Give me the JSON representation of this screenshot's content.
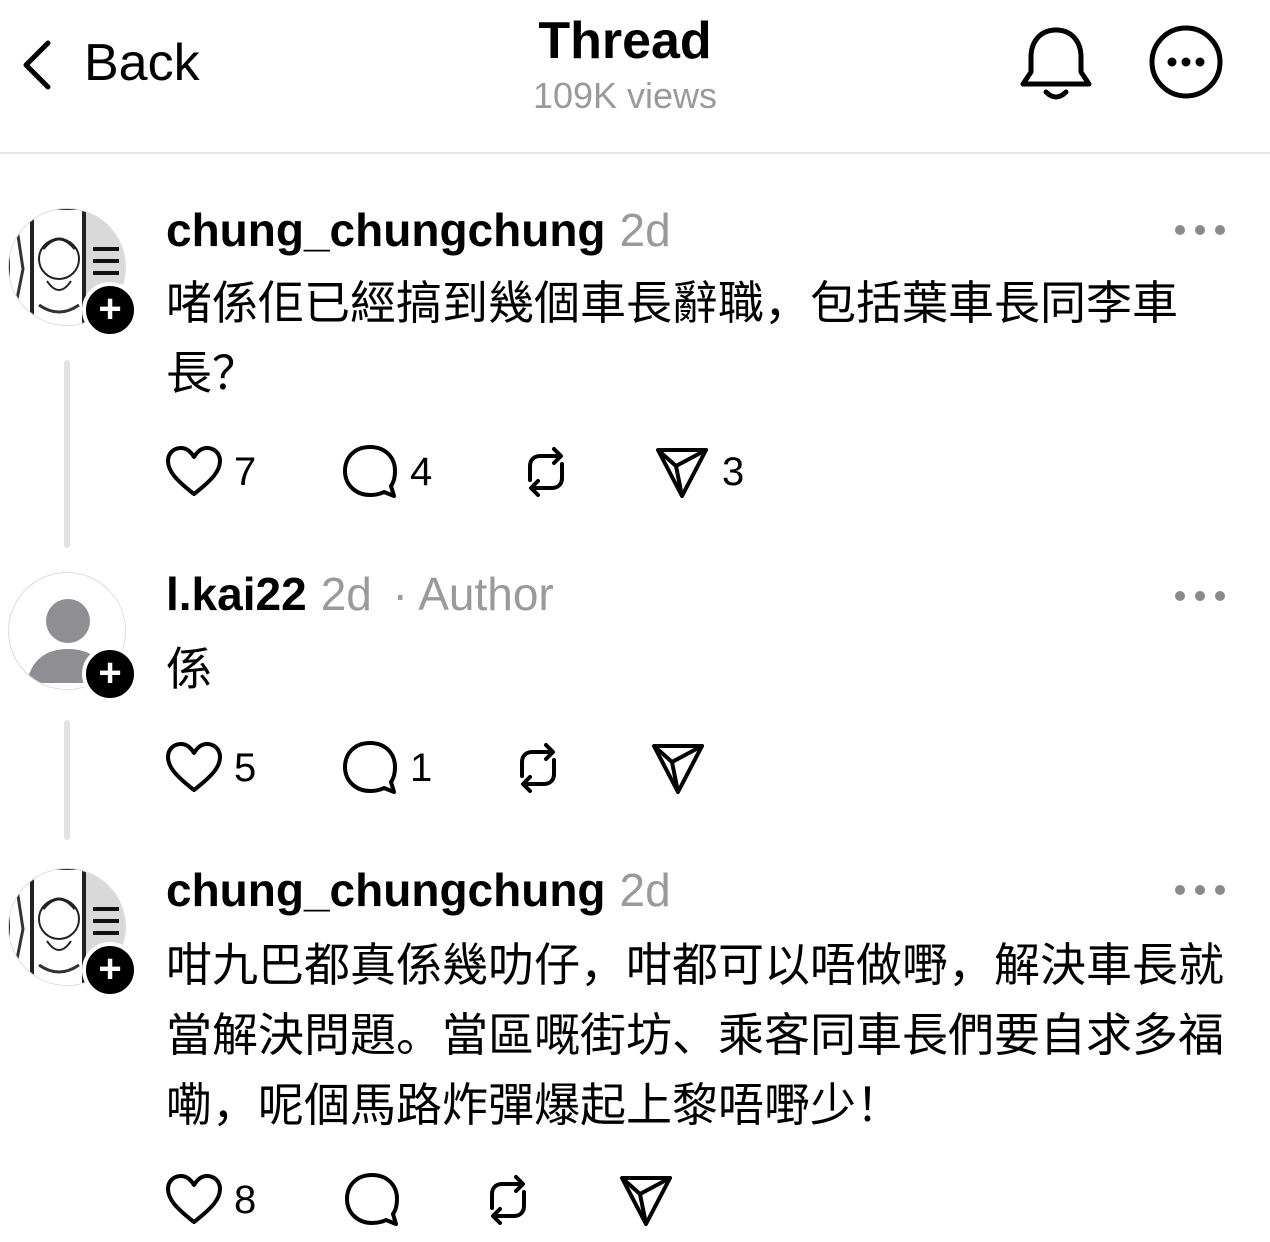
{
  "header": {
    "back_label": "Back",
    "title": "Thread",
    "views": "109K views",
    "bell_icon": "bell-icon",
    "more_icon": "more-circle-icon"
  },
  "posts": [
    {
      "username": "chung_chungchung",
      "time": "2d",
      "author_tag": "",
      "text": "啫係佢已經搞到幾個車長辭職，包括葉車長同李車長？",
      "likes": "7",
      "replies": "4",
      "reposts": "",
      "shares": "3",
      "avatar": "manga-avatar"
    },
    {
      "username": "l.kai22",
      "time": "2d",
      "author_tag": "· Author",
      "text": "係",
      "likes": "5",
      "replies": "1",
      "reposts": "",
      "shares": "",
      "avatar": "default-avatar"
    },
    {
      "username": "chung_chungchung",
      "time": "2d",
      "author_tag": "",
      "text": "咁九巴都真係幾叻仔，咁都可以唔做嘢，解決車長就當解決問題。當區嘅街坊、乘客同車長們要自求多福嘞，呢個馬路炸彈爆起上黎唔嘢少！",
      "likes": "8",
      "replies": "",
      "reposts": "",
      "shares": "",
      "avatar": "manga-avatar"
    }
  ],
  "colors": {
    "muted": "#9a9a9a",
    "divider": "#e6e6e6",
    "thread_line": "#e1e1e1"
  }
}
